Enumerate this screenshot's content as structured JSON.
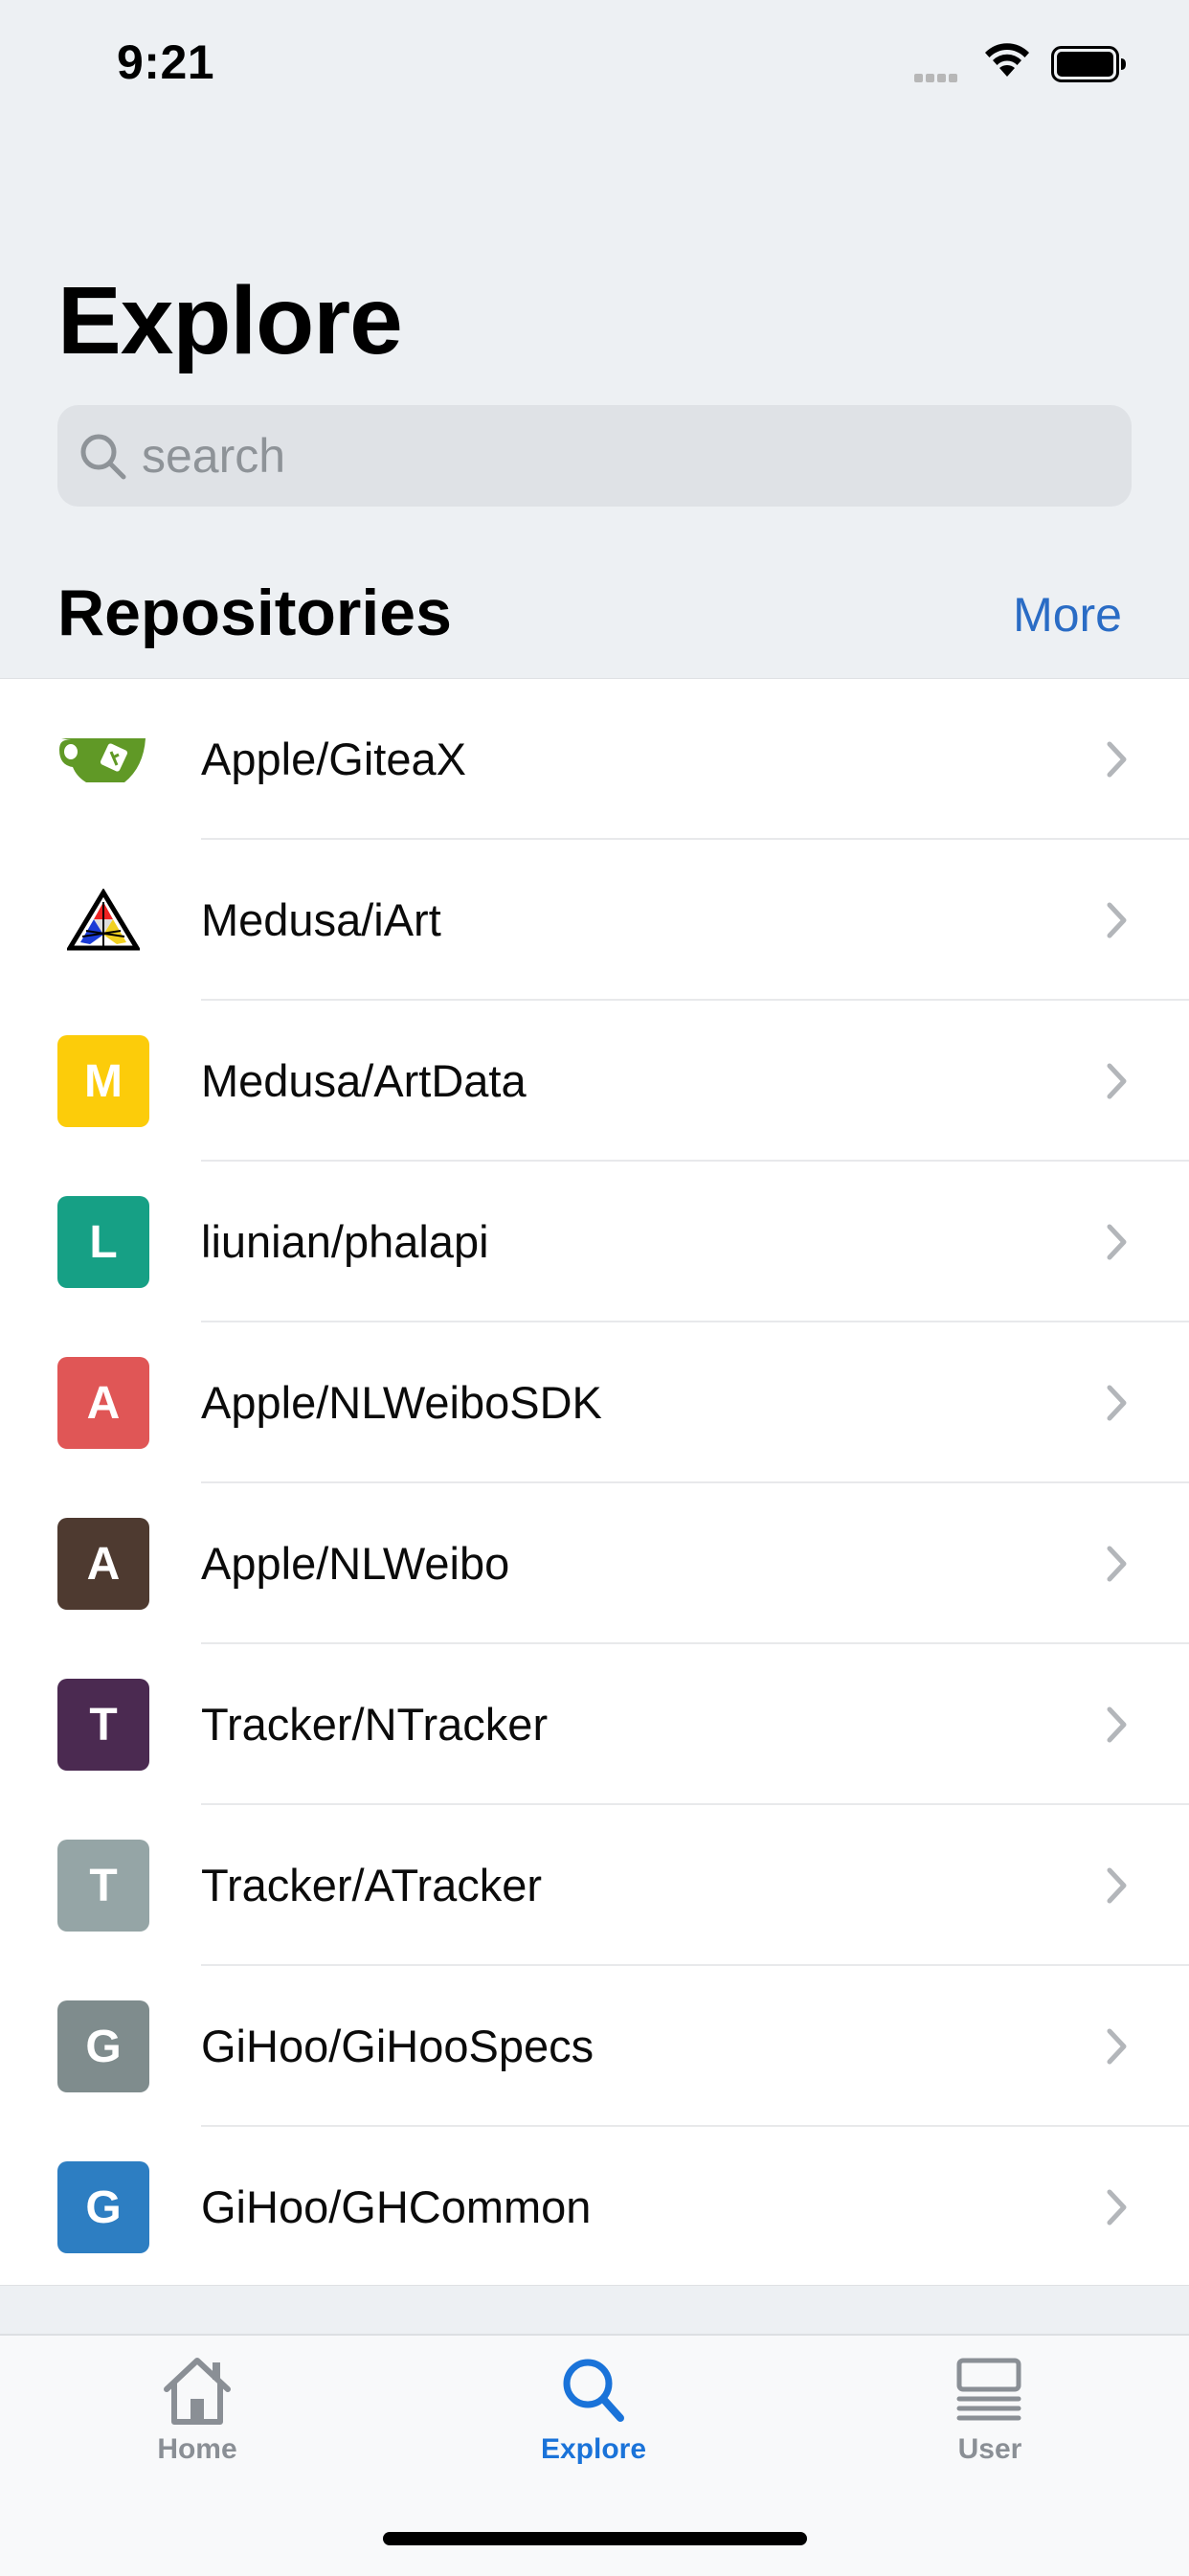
{
  "status_bar": {
    "time": "9:21"
  },
  "header": {
    "title": "Explore"
  },
  "search": {
    "placeholder": "search",
    "value": ""
  },
  "section": {
    "title": "Repositories",
    "more_label": "More"
  },
  "repositories": [
    {
      "name": "Apple/GiteaX",
      "avatar_letter": "",
      "avatar_icon": "gitea-logo-icon",
      "avatar_color": "#609926"
    },
    {
      "name": "Medusa/iArt",
      "avatar_letter": "",
      "avatar_icon": "triangle-cube-logo-icon",
      "avatar_color": "#000000"
    },
    {
      "name": "Medusa/ArtData",
      "avatar_letter": "M",
      "avatar_color": "#fccc0a"
    },
    {
      "name": "liunian/phalapi",
      "avatar_letter": "L",
      "avatar_color": "#16a085"
    },
    {
      "name": "Apple/NLWeiboSDK",
      "avatar_letter": "A",
      "avatar_color": "#e05656"
    },
    {
      "name": "Apple/NLWeibo",
      "avatar_letter": "A",
      "avatar_color": "#4e3a30"
    },
    {
      "name": "Tracker/NTracker",
      "avatar_letter": "T",
      "avatar_color": "#4b2a51"
    },
    {
      "name": "Tracker/ATracker",
      "avatar_letter": "T",
      "avatar_color": "#95a5a6"
    },
    {
      "name": "GiHoo/GiHooSpecs",
      "avatar_letter": "G",
      "avatar_color": "#7f8c8d"
    },
    {
      "name": "GiHoo/GHCommon",
      "avatar_letter": "G",
      "avatar_color": "#2d7ec2"
    }
  ],
  "tab_bar": {
    "tabs": [
      {
        "label": "Home",
        "icon": "house-icon",
        "active": false
      },
      {
        "label": "Explore",
        "icon": "magnifier-icon",
        "active": true
      },
      {
        "label": "User",
        "icon": "list-card-icon",
        "active": false
      }
    ],
    "accent_color": "#1a73d9",
    "inactive_color": "#8a8f95"
  }
}
